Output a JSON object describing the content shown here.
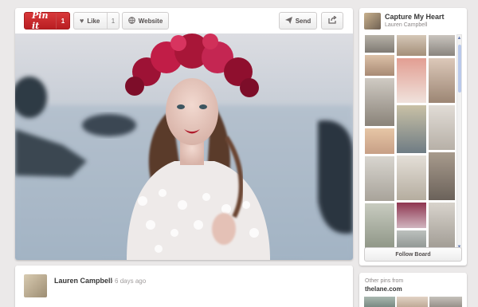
{
  "toolbar": {
    "pinit_label": "Pin it",
    "pinit_count": "1",
    "like_label": "Like",
    "like_count": "1",
    "website_label": "Website",
    "send_label": "Send"
  },
  "pinner": {
    "name": "Lauren Campbell",
    "time": "• 6 days ago"
  },
  "board": {
    "title": "Capture My Heart",
    "owner": "Lauren Campbell",
    "follow_label": "Follow Board"
  },
  "source": {
    "label": "Other pins from",
    "domain": "thelane.com"
  },
  "icons": {
    "share": "share-icon",
    "send": "send-icon",
    "heart": "heart-icon",
    "globe": "globe-icon"
  },
  "colors": {
    "pinit_red": "#cb2027",
    "background": "#ebe9e9"
  }
}
